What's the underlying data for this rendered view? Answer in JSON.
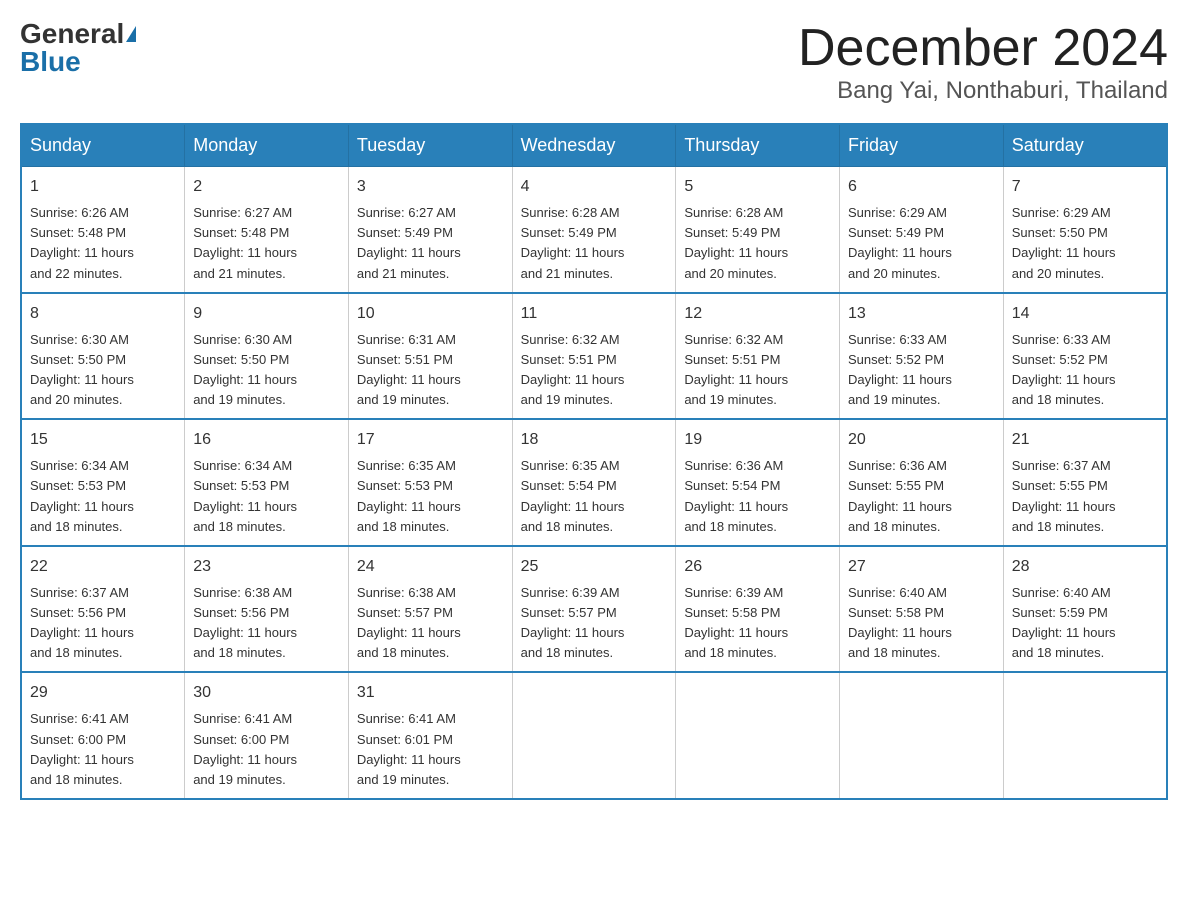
{
  "header": {
    "logo_general": "General",
    "logo_blue": "Blue",
    "month_title": "December 2024",
    "location": "Bang Yai, Nonthaburi, Thailand"
  },
  "days_of_week": [
    "Sunday",
    "Monday",
    "Tuesday",
    "Wednesday",
    "Thursday",
    "Friday",
    "Saturday"
  ],
  "weeks": [
    [
      {
        "day": "1",
        "sunrise": "6:26 AM",
        "sunset": "5:48 PM",
        "daylight": "11 hours and 22 minutes."
      },
      {
        "day": "2",
        "sunrise": "6:27 AM",
        "sunset": "5:48 PM",
        "daylight": "11 hours and 21 minutes."
      },
      {
        "day": "3",
        "sunrise": "6:27 AM",
        "sunset": "5:49 PM",
        "daylight": "11 hours and 21 minutes."
      },
      {
        "day": "4",
        "sunrise": "6:28 AM",
        "sunset": "5:49 PM",
        "daylight": "11 hours and 21 minutes."
      },
      {
        "day": "5",
        "sunrise": "6:28 AM",
        "sunset": "5:49 PM",
        "daylight": "11 hours and 20 minutes."
      },
      {
        "day": "6",
        "sunrise": "6:29 AM",
        "sunset": "5:49 PM",
        "daylight": "11 hours and 20 minutes."
      },
      {
        "day": "7",
        "sunrise": "6:29 AM",
        "sunset": "5:50 PM",
        "daylight": "11 hours and 20 minutes."
      }
    ],
    [
      {
        "day": "8",
        "sunrise": "6:30 AM",
        "sunset": "5:50 PM",
        "daylight": "11 hours and 20 minutes."
      },
      {
        "day": "9",
        "sunrise": "6:30 AM",
        "sunset": "5:50 PM",
        "daylight": "11 hours and 19 minutes."
      },
      {
        "day": "10",
        "sunrise": "6:31 AM",
        "sunset": "5:51 PM",
        "daylight": "11 hours and 19 minutes."
      },
      {
        "day": "11",
        "sunrise": "6:32 AM",
        "sunset": "5:51 PM",
        "daylight": "11 hours and 19 minutes."
      },
      {
        "day": "12",
        "sunrise": "6:32 AM",
        "sunset": "5:51 PM",
        "daylight": "11 hours and 19 minutes."
      },
      {
        "day": "13",
        "sunrise": "6:33 AM",
        "sunset": "5:52 PM",
        "daylight": "11 hours and 19 minutes."
      },
      {
        "day": "14",
        "sunrise": "6:33 AM",
        "sunset": "5:52 PM",
        "daylight": "11 hours and 18 minutes."
      }
    ],
    [
      {
        "day": "15",
        "sunrise": "6:34 AM",
        "sunset": "5:53 PM",
        "daylight": "11 hours and 18 minutes."
      },
      {
        "day": "16",
        "sunrise": "6:34 AM",
        "sunset": "5:53 PM",
        "daylight": "11 hours and 18 minutes."
      },
      {
        "day": "17",
        "sunrise": "6:35 AM",
        "sunset": "5:53 PM",
        "daylight": "11 hours and 18 minutes."
      },
      {
        "day": "18",
        "sunrise": "6:35 AM",
        "sunset": "5:54 PM",
        "daylight": "11 hours and 18 minutes."
      },
      {
        "day": "19",
        "sunrise": "6:36 AM",
        "sunset": "5:54 PM",
        "daylight": "11 hours and 18 minutes."
      },
      {
        "day": "20",
        "sunrise": "6:36 AM",
        "sunset": "5:55 PM",
        "daylight": "11 hours and 18 minutes."
      },
      {
        "day": "21",
        "sunrise": "6:37 AM",
        "sunset": "5:55 PM",
        "daylight": "11 hours and 18 minutes."
      }
    ],
    [
      {
        "day": "22",
        "sunrise": "6:37 AM",
        "sunset": "5:56 PM",
        "daylight": "11 hours and 18 minutes."
      },
      {
        "day": "23",
        "sunrise": "6:38 AM",
        "sunset": "5:56 PM",
        "daylight": "11 hours and 18 minutes."
      },
      {
        "day": "24",
        "sunrise": "6:38 AM",
        "sunset": "5:57 PM",
        "daylight": "11 hours and 18 minutes."
      },
      {
        "day": "25",
        "sunrise": "6:39 AM",
        "sunset": "5:57 PM",
        "daylight": "11 hours and 18 minutes."
      },
      {
        "day": "26",
        "sunrise": "6:39 AM",
        "sunset": "5:58 PM",
        "daylight": "11 hours and 18 minutes."
      },
      {
        "day": "27",
        "sunrise": "6:40 AM",
        "sunset": "5:58 PM",
        "daylight": "11 hours and 18 minutes."
      },
      {
        "day": "28",
        "sunrise": "6:40 AM",
        "sunset": "5:59 PM",
        "daylight": "11 hours and 18 minutes."
      }
    ],
    [
      {
        "day": "29",
        "sunrise": "6:41 AM",
        "sunset": "6:00 PM",
        "daylight": "11 hours and 18 minutes."
      },
      {
        "day": "30",
        "sunrise": "6:41 AM",
        "sunset": "6:00 PM",
        "daylight": "11 hours and 19 minutes."
      },
      {
        "day": "31",
        "sunrise": "6:41 AM",
        "sunset": "6:01 PM",
        "daylight": "11 hours and 19 minutes."
      },
      null,
      null,
      null,
      null
    ]
  ],
  "labels": {
    "sunrise": "Sunrise:",
    "sunset": "Sunset:",
    "daylight": "Daylight:"
  }
}
